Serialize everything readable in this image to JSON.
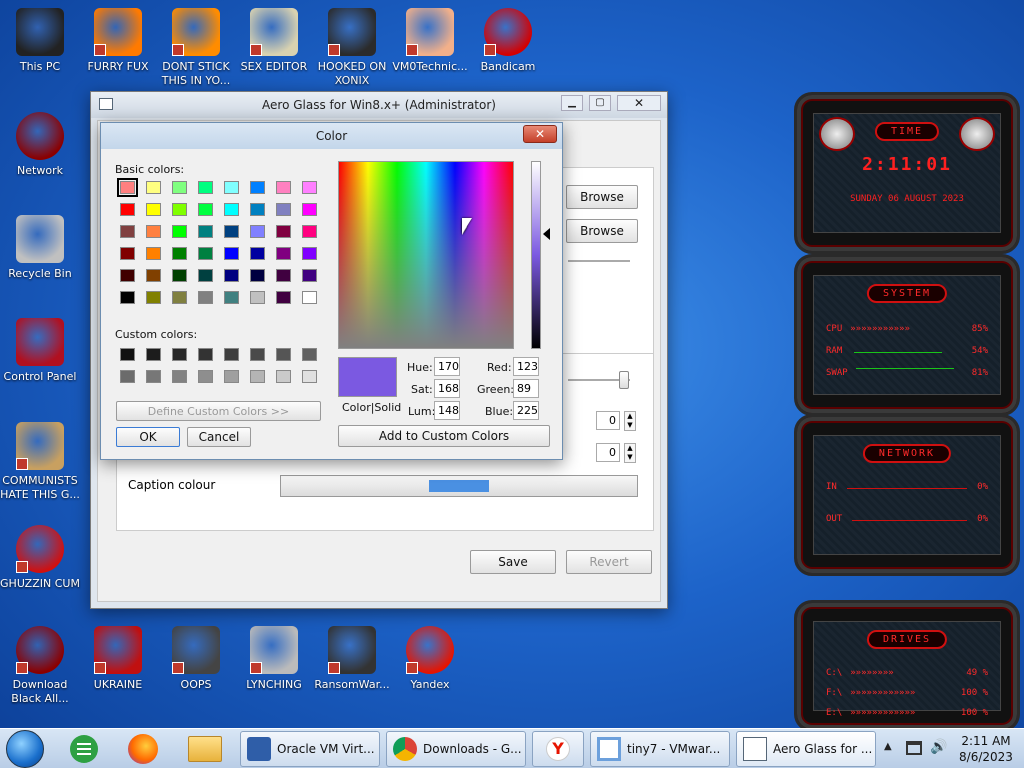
{
  "desktop_icons": [
    {
      "label": "This PC"
    },
    {
      "label": "FURRY FUX"
    },
    {
      "label": "DONT STICK THIS IN YO..."
    },
    {
      "label": "SEX EDITOR"
    },
    {
      "label": "HOOKED ON XONIX"
    },
    {
      "label": "VM0Technic..."
    },
    {
      "label": "Bandicam"
    },
    {
      "label": "Network"
    },
    {
      "label": "Recycle Bin"
    },
    {
      "label": "Control Panel"
    },
    {
      "label": "COMMUNISTS HATE THIS G..."
    },
    {
      "label": "GHUZZIN CUM"
    },
    {
      "label": "Download Black All..."
    },
    {
      "label": "UKRAINE"
    },
    {
      "label": "OOPS"
    },
    {
      "label": "LYNCHING"
    },
    {
      "label": "RansomWar..."
    },
    {
      "label": "Yandex"
    }
  ],
  "aero_window": {
    "title": "Aero Glass for Win8.x+ (Administrator)",
    "browse1": "Browse",
    "browse2": "Browse",
    "caption_label": "Caption colour",
    "caption_color": "#4a90e2",
    "spin1": "0",
    "spin2": "0",
    "save": "Save",
    "revert": "Revert"
  },
  "color_dialog": {
    "title": "Color",
    "basic_label": "Basic colors:",
    "custom_label": "Custom colors:",
    "define_btn": "Define Custom Colors >>",
    "ok": "OK",
    "cancel": "Cancel",
    "add_btn": "Add to Custom Colors",
    "color_solid": "Color|Solid",
    "hue_label": "Hue:",
    "hue": "170",
    "sat_label": "Sat:",
    "sat": "168",
    "lum_label": "Lum:",
    "lum": "148",
    "red_label": "Red:",
    "red": "123",
    "green_label": "Green:",
    "green": "89",
    "blue_label": "Blue:",
    "blue": "225",
    "selected_color": "#7b59e1",
    "basic_colors": [
      "#ff8080",
      "#ffff80",
      "#80ff80",
      "#00ff80",
      "#80ffff",
      "#0080ff",
      "#ff80c0",
      "#ff80ff",
      "#ff0000",
      "#ffff00",
      "#80ff00",
      "#00ff40",
      "#00ffff",
      "#0080c0",
      "#8080c0",
      "#ff00ff",
      "#804040",
      "#ff8040",
      "#00ff00",
      "#008080",
      "#004080",
      "#8080ff",
      "#800040",
      "#ff0080",
      "#800000",
      "#ff8000",
      "#008000",
      "#008040",
      "#0000ff",
      "#0000a0",
      "#800080",
      "#8000ff",
      "#400000",
      "#804000",
      "#004000",
      "#004040",
      "#000080",
      "#000040",
      "#400040",
      "#400080",
      "#000000",
      "#808000",
      "#808040",
      "#808080",
      "#408080",
      "#c0c0c0",
      "#400040",
      "#ffffff"
    ],
    "custom_colors": [
      "#111111",
      "#1c1c1c",
      "#272727",
      "#333333",
      "#3e3e3e",
      "#4a4a4a",
      "#555555",
      "#606060",
      "#6b6b6b",
      "#777777",
      "#828282",
      "#8e8e8e",
      "#9f9f9f",
      "#b4b4b4",
      "#cacaca",
      "#e0e0e0"
    ]
  },
  "gadgets": {
    "time_title": "TIME",
    "time_value": "2:11:01",
    "date_value": "SUNDAY 06 AUGUST 2023",
    "system_title": "SYSTEM",
    "cpu_label": "CPU",
    "cpu_value": "85%",
    "ram_label": "RAM",
    "ram_value": "54%",
    "swap_label": "SWAP",
    "swap_value": "81%",
    "network_title": "NETWORK",
    "in_label": "IN",
    "in_value": "0%",
    "out_label": "OUT",
    "out_value": "0%",
    "drives_title": "DRIVES",
    "c_label": "C:\\",
    "c_value": "49 %",
    "f_label": "F:\\",
    "f_value": "100 %",
    "e_label": "E:\\",
    "e_value": "100 %"
  },
  "taskbar": {
    "vbox": "Oracle VM Virt...",
    "chrome": "Downloads - G...",
    "vmware": "tiny7 - VMwar...",
    "aero": "Aero Glass for ...",
    "time": "2:11 AM",
    "date": "8/6/2023"
  }
}
